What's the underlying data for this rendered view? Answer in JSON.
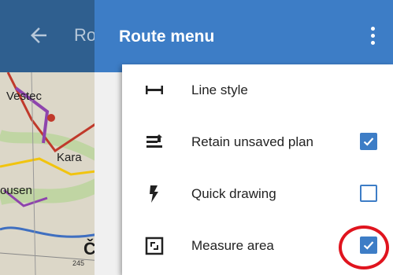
{
  "background_app": {
    "title": "Ro",
    "map_labels": [
      "Vestec",
      "Kara",
      "ousen",
      "Č",
      "245"
    ]
  },
  "header": {
    "title": "Route menu",
    "color": "#3d7dc6"
  },
  "menu": {
    "items": [
      {
        "label": "Line style",
        "icon": "line-style-icon",
        "has_checkbox": false
      },
      {
        "label": "Retain unsaved plan",
        "icon": "retain-plan-icon",
        "has_checkbox": true,
        "checked": true
      },
      {
        "label": "Quick drawing",
        "icon": "lightning-icon",
        "has_checkbox": true,
        "checked": false
      },
      {
        "label": "Measure area",
        "icon": "measure-area-icon",
        "has_checkbox": true,
        "checked": true,
        "highlighted": true
      }
    ]
  },
  "colors": {
    "accent": "#3d7dc6",
    "highlight": "#e0141e"
  }
}
